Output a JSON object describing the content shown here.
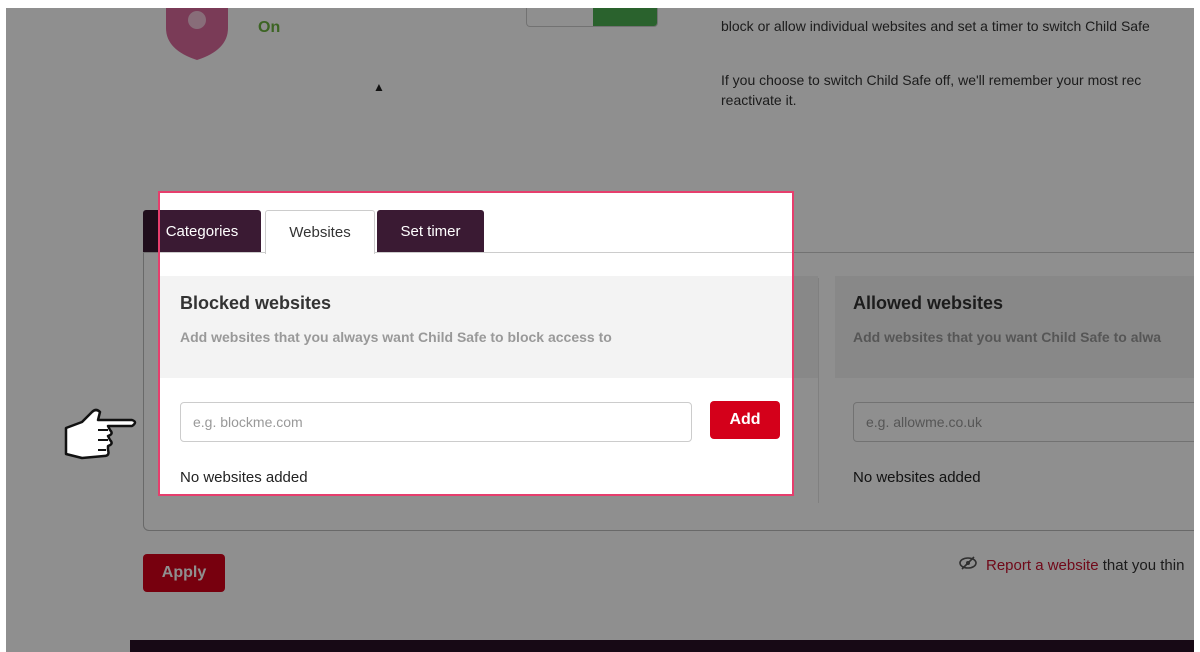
{
  "status": {
    "label": "On"
  },
  "info": {
    "line1": "block or allow individual websites and set a timer to switch Child Safe",
    "line2a": "If you choose to switch Child Safe off, we'll remember your most rec",
    "line2b": "reactivate it."
  },
  "tabs": [
    {
      "label": "Categories"
    },
    {
      "label": "Websites"
    },
    {
      "label": "Set timer"
    }
  ],
  "blocked": {
    "title": "Blocked websites",
    "subtitle": "Add websites that you always want Child Safe to block access to",
    "placeholder": "e.g. blockme.com",
    "add_label": "Add",
    "empty": "No websites added"
  },
  "allowed": {
    "title": "Allowed websites",
    "subtitle": "Add websites that you want Child Safe to alwa",
    "placeholder": "e.g. allowme.co.uk",
    "empty": "No websites added"
  },
  "apply_label": "Apply",
  "report": {
    "link": "Report a website",
    "rest": " that you thin"
  },
  "colors": {
    "accent": "#d4001a",
    "tab_dark": "#3a1a33",
    "highlight": "#e63e6d",
    "on_green": "#6cb33f"
  }
}
